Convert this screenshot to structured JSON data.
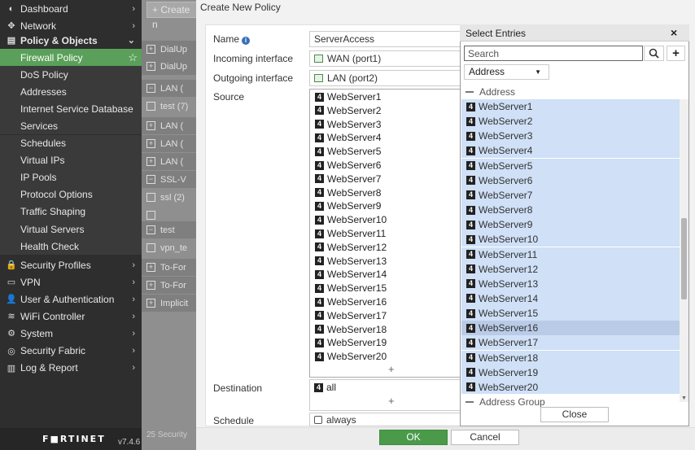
{
  "sidebar": {
    "top_items": [
      {
        "icon": "dashboard-icon",
        "glyph": "◐",
        "label": "Dashboard",
        "chevron": "›"
      },
      {
        "icon": "network-icon",
        "glyph": "✥",
        "label": "Network",
        "chevron": "›"
      }
    ],
    "section": {
      "icon": "policy-icon",
      "glyph": "▤",
      "label": "Policy & Objects",
      "chevron": "⌄"
    },
    "sub_items": [
      {
        "label": "Firewall Policy",
        "active": true
      },
      {
        "label": "DoS Policy"
      },
      {
        "label": "Addresses"
      },
      {
        "label": "Internet Service Database"
      },
      {
        "label": "Services"
      },
      {
        "label": "Schedules"
      },
      {
        "label": "Virtual IPs"
      },
      {
        "label": "IP Pools"
      },
      {
        "label": "Protocol Options"
      },
      {
        "label": "Traffic Shaping"
      },
      {
        "label": "Virtual Servers"
      },
      {
        "label": "Health Check"
      }
    ],
    "bottom_items": [
      {
        "icon": "lock-icon",
        "glyph": "🔒",
        "label": "Security Profiles",
        "chevron": "›"
      },
      {
        "icon": "vpn-icon",
        "glyph": "▭",
        "label": "VPN",
        "chevron": "›"
      },
      {
        "icon": "user-icon",
        "glyph": "👤",
        "label": "User & Authentication",
        "chevron": "›"
      },
      {
        "icon": "wifi-icon",
        "glyph": "≋",
        "label": "WiFi Controller",
        "chevron": "›"
      },
      {
        "icon": "gear-icon",
        "glyph": "⚙",
        "label": "System",
        "chevron": "›"
      },
      {
        "icon": "fabric-icon",
        "glyph": "◎",
        "label": "Security Fabric",
        "chevron": "›"
      },
      {
        "icon": "chart-icon",
        "glyph": "▥",
        "label": "Log & Report",
        "chevron": "›"
      }
    ],
    "logo": "F■RTINET",
    "version": "v7.4.6"
  },
  "background": {
    "create_label": "+ Create n",
    "rows": [
      {
        "box": "+",
        "label": "DialUp",
        "group": true
      },
      {
        "box": "+",
        "label": "DialUp",
        "group": true
      },
      {
        "box": "−",
        "label": "LAN (",
        "group": true
      },
      {
        "box": "",
        "label": "test (7)",
        "group": false
      },
      {
        "box": "+",
        "label": "LAN (",
        "group": true
      },
      {
        "box": "+",
        "label": "LAN (",
        "group": true
      },
      {
        "box": "+",
        "label": "LAN (",
        "group": true
      },
      {
        "box": "−",
        "label": "SSL-V",
        "group": true
      },
      {
        "box": "",
        "label": "ssl (2)",
        "group": false
      },
      {
        "box": "",
        "label": "",
        "group": false
      },
      {
        "box": "−",
        "label": "test",
        "group": true
      },
      {
        "box": "",
        "label": "vpn_te",
        "group": false
      },
      {
        "box": "+",
        "label": "To-For",
        "group": true
      },
      {
        "box": "+",
        "label": "To-For",
        "group": true
      },
      {
        "box": "+",
        "label": "Implicit",
        "group": true
      }
    ],
    "footer_badge": "25 Security"
  },
  "modal": {
    "title": "Create New Policy",
    "fields": {
      "name_label": "Name",
      "name_info": "i",
      "name_value": "ServerAccess",
      "incoming_label": "Incoming interface",
      "incoming_value": "WAN (port1)",
      "outgoing_label": "Outgoing interface",
      "outgoing_value": "LAN (port2)",
      "source_label": "Source",
      "destination_label": "Destination",
      "destination_value": "all",
      "schedule_label": "Schedule",
      "schedule_value": "always"
    },
    "source_items": [
      "WebServer1",
      "WebServer2",
      "WebServer3",
      "WebServer4",
      "WebServer5",
      "WebServer6",
      "WebServer7",
      "WebServer8",
      "WebServer9",
      "WebServer10",
      "WebServer11",
      "WebServer12",
      "WebServer13",
      "WebServer14",
      "WebServer15",
      "WebServer16",
      "WebServer17",
      "WebServer18",
      "WebServer19",
      "WebServer20"
    ],
    "add_symbol": "+",
    "ok_label": "OK",
    "cancel_label": "Cancel"
  },
  "panel": {
    "title": "Select Entries",
    "close_x": "×",
    "search_placeholder": "Search",
    "add_symbol": "+",
    "type_value": "Address",
    "group_address": "Address",
    "group_address_group": "Address Group",
    "entries": [
      "WebServer1",
      "WebServer2",
      "WebServer3",
      "WebServer4",
      "WebServer5",
      "WebServer6",
      "WebServer7",
      "WebServer8",
      "WebServer9",
      "WebServer10",
      "WebServer11",
      "WebServer12",
      "WebServer13",
      "WebServer14",
      "WebServer15",
      "WebServer16",
      "WebServer17",
      "WebServer18",
      "WebServer19",
      "WebServer20"
    ],
    "hovered_entry": "WebServer16",
    "close_label": "Close"
  },
  "colors": {
    "accent_green": "#5aa05a",
    "selected_blue": "#cfe0f7",
    "sidebar_bg": "#2e2e2e"
  }
}
